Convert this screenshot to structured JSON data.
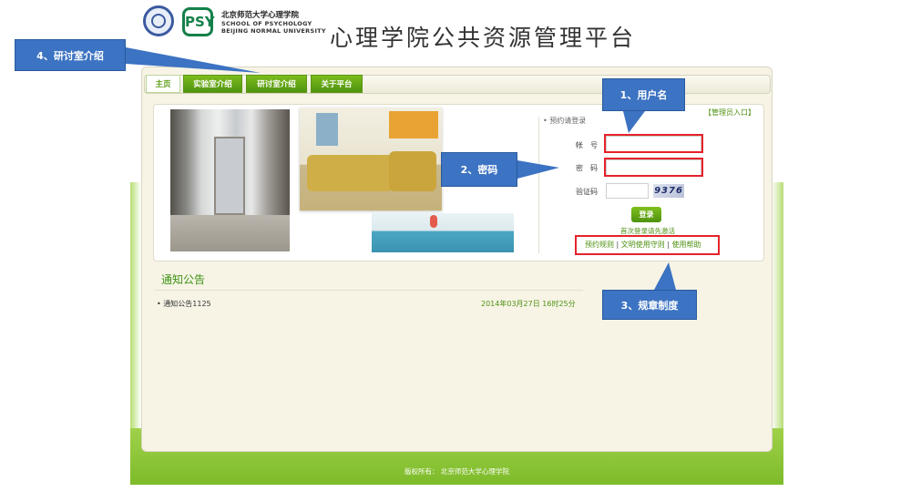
{
  "header": {
    "school_cn": "北京师范大学心理学院",
    "school_en_line1": "SCHOOL OF PSYCHOLOGY",
    "school_en_line2": "BEIJING NORMAL UNIVERSITY",
    "logo2_text": "PSY",
    "platform_title": "心理学院公共资源管理平台"
  },
  "tabs": [
    {
      "label": "主页",
      "active": true
    },
    {
      "label": "实验室介绍"
    },
    {
      "label": "研讨室介绍"
    },
    {
      "label": "关于平台"
    }
  ],
  "login": {
    "admin_link": "【管理员入口】",
    "hint": "• 预约请登录",
    "account_label": "帐号",
    "password_label": "密码",
    "captcha_label": "验证码",
    "captcha_value": "9376",
    "button_label": "登录",
    "first_login_link": "首次登录请先激活",
    "rules": [
      "预约规则",
      "文明使用守则",
      "使用帮助"
    ],
    "separator": " | "
  },
  "notices": {
    "title": "通知公告",
    "items": [
      {
        "text": "• 通知公告1125",
        "date": "2014年03月27日 16时25分"
      }
    ]
  },
  "footer": {
    "copyright": "版权所有： 北京师范大学心理学院"
  },
  "annotations": {
    "callout_4": "4、研讨室介绍",
    "callout_1": "1、用户名",
    "callout_2": "2、密码",
    "callout_3": "3、规章制度"
  },
  "colors": {
    "brand_green": "#5c9d16",
    "callout_blue": "#3c73c2",
    "highlight_red": "#e5232a"
  }
}
